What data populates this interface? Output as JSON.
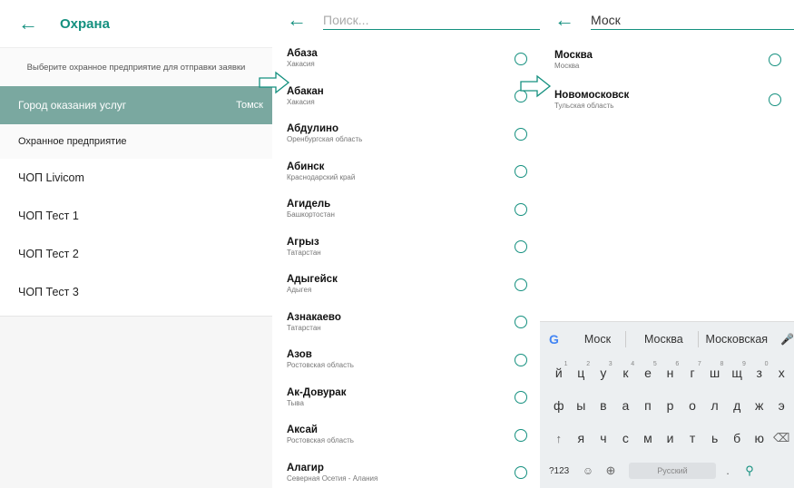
{
  "panel1": {
    "back_glyph": "←",
    "title": "Охрана",
    "hint": "Выберите охранное предприятие для отправки заявки",
    "city_label": "Город оказания услуг",
    "city_value": "Томск",
    "agency_header": "Охранное предприятие",
    "agencies": [
      "ЧОП Livicom",
      "ЧОП Тест 1",
      "ЧОП Тест 2",
      "ЧОП Тест 3"
    ]
  },
  "panel2": {
    "back_glyph": "←",
    "search_placeholder": "Поиск...",
    "items": [
      {
        "name": "Абаза",
        "region": "Хакасия"
      },
      {
        "name": "Абакан",
        "region": "Хакасия"
      },
      {
        "name": "Абдулино",
        "region": "Оренбургская область"
      },
      {
        "name": "Абинск",
        "region": "Краснодарский край"
      },
      {
        "name": "Агидель",
        "region": "Башкортостан"
      },
      {
        "name": "Агрыз",
        "region": "Татарстан"
      },
      {
        "name": "Адыгейск",
        "region": "Адыгея"
      },
      {
        "name": "Азнакаево",
        "region": "Татарстан"
      },
      {
        "name": "Азов",
        "region": "Ростовская область"
      },
      {
        "name": "Ак-Довурак",
        "region": "Тыва"
      },
      {
        "name": "Аксай",
        "region": "Ростовская область"
      },
      {
        "name": "Алагир",
        "region": "Северная Осетия - Алания"
      }
    ]
  },
  "panel3": {
    "back_glyph": "←",
    "search_value": "Моск",
    "items": [
      {
        "name": "Москва",
        "region": "Москва"
      },
      {
        "name": "Новомосковск",
        "region": "Тульская область"
      }
    ],
    "keyboard": {
      "suggestions": [
        "Моск",
        "Москва",
        "Московская"
      ],
      "row1": [
        "й",
        "ц",
        "у",
        "к",
        "е",
        "н",
        "г",
        "ш",
        "щ",
        "з",
        "х"
      ],
      "row1_hints": [
        "1",
        "2",
        "3",
        "4",
        "5",
        "6",
        "7",
        "8",
        "9",
        "0",
        ""
      ],
      "row2": [
        "ф",
        "ы",
        "в",
        "а",
        "п",
        "р",
        "о",
        "л",
        "д",
        "ж",
        "э"
      ],
      "row3": [
        "я",
        "ч",
        "с",
        "м",
        "и",
        "т",
        "ь",
        "б",
        "ю"
      ],
      "num_key": "?123",
      "space_label": "Русский",
      "dot_key": "."
    }
  },
  "colors": {
    "accent": "#14907f",
    "city_row": "#7aa8a0"
  }
}
